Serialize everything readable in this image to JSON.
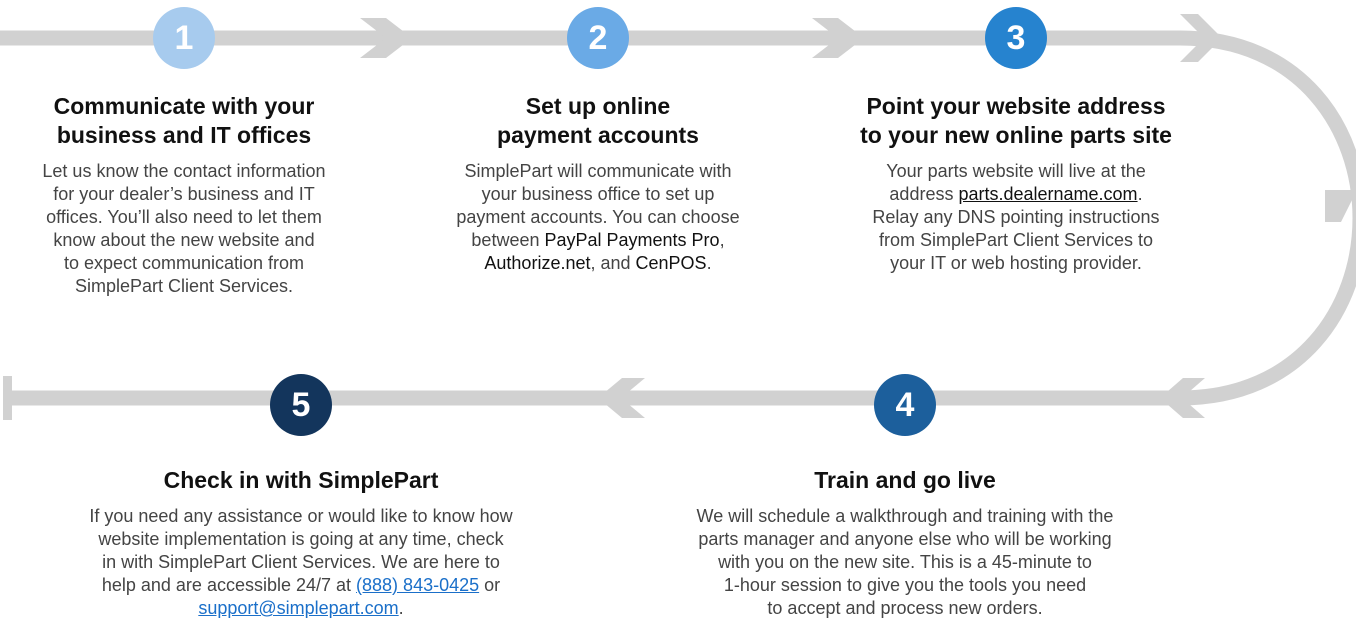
{
  "steps": [
    {
      "number": "1",
      "color": "#a7cbee",
      "title_lines": [
        "Communicate with your",
        "business and IT offices"
      ],
      "body_lines": [
        "Let us know the contact information",
        "for your dealer’s business and IT",
        "offices. You’ll also need to let them",
        "know about the new website and",
        "to expect communication from",
        "SimplePart Client Services."
      ]
    },
    {
      "number": "2",
      "color": "#6aaae6",
      "title_lines": [
        "Set up online",
        "payment accounts"
      ],
      "body_lines": [
        "SimplePart will communicate with",
        "your business office to set up",
        "payment accounts. You can choose"
      ],
      "body_line4_prefix": "between ",
      "paypal": "PayPal Payments Pro",
      "comma": ",",
      "authorize": "Authorize.net",
      "and_text": ", and ",
      "cenpos": "CenPOS",
      "period": "."
    },
    {
      "number": "3",
      "color": "#2683cf",
      "title_lines": [
        "Point your website address",
        "to your new online parts site"
      ],
      "body_line1": "Your parts website will live at the",
      "address_prefix": "address ",
      "address_link": "parts.dealername.com",
      "address_suffix": ".",
      "body_rest": [
        "Relay any DNS pointing instructions",
        "from SimplePart Client Services to",
        "your IT or web hosting provider."
      ]
    },
    {
      "number": "4",
      "color": "#1c5f9c",
      "title_lines": [
        "Train and go live"
      ],
      "body_lines": [
        "We will schedule a walkthrough and training with the",
        "parts manager and anyone else who will be working",
        "with you on the new site. This is a 45-minute to",
        "1-hour session to give you the tools you need",
        "to accept and process new orders."
      ]
    },
    {
      "number": "5",
      "color": "#13355c",
      "title_lines": [
        "Check in with SimplePart"
      ],
      "body_lines": [
        "If you need any assistance or would like to know how",
        "website implementation is going at any time, check",
        "in with SimplePart Client Services. We are here to"
      ],
      "body_line4_prefix": "help and are accessible 24/7 at ",
      "phone": "(888) 843-0425",
      "or_text": " or",
      "email": "support@simplepart.com",
      "email_suffix": "."
    }
  ],
  "colors": {
    "track": "#d1d1d1",
    "heading": "#111111",
    "body": "#444444",
    "link": "#1a6fc9"
  }
}
